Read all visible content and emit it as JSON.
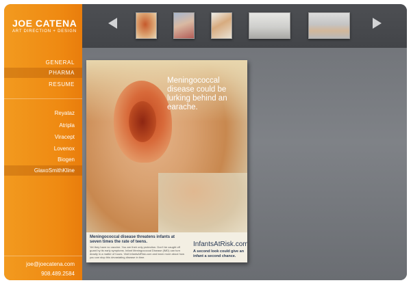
{
  "brand": {
    "name": "JOE CATENA",
    "subtitle": "ART DIRECTION + DESIGN"
  },
  "nav": [
    {
      "label": "GENERAL",
      "active": false
    },
    {
      "label": "PHARMA",
      "active": true
    },
    {
      "label": "RESUME",
      "active": false
    }
  ],
  "clients": [
    {
      "label": "Reyataz",
      "active": false
    },
    {
      "label": "Atripla",
      "active": false
    },
    {
      "label": "Viracept",
      "active": false
    },
    {
      "label": "Lovenox",
      "active": false
    },
    {
      "label": "Biogen",
      "active": false
    },
    {
      "label": "GlaxoSmithKline",
      "active": true
    }
  ],
  "contact": {
    "email": "joe@joecatena.com",
    "phone": "908.489.2584"
  },
  "poster": {
    "headline": "Meningococcal disease could be lurking behind an earache.",
    "caption_title": "Meningococcal disease threatens infants at seven times the rate of teens.",
    "caption_body": "Yet they have no vaccine. You are their only protection. Don't be caught off guard by its early symptoms. Infant Meningococcal Disease (IMD) can turn deadly in a matter of hours. Visit InfantsAtRisk.com and learn more about how you can stop this devastating disease in time.",
    "logo": "InfantsAtRisk.com",
    "tagline": "A second look could give an infant a second chance."
  },
  "colors": {
    "sidebar_orange": "#ef8a12",
    "topbar_gray": "#45474b",
    "main_gray": "#7a7d82"
  }
}
